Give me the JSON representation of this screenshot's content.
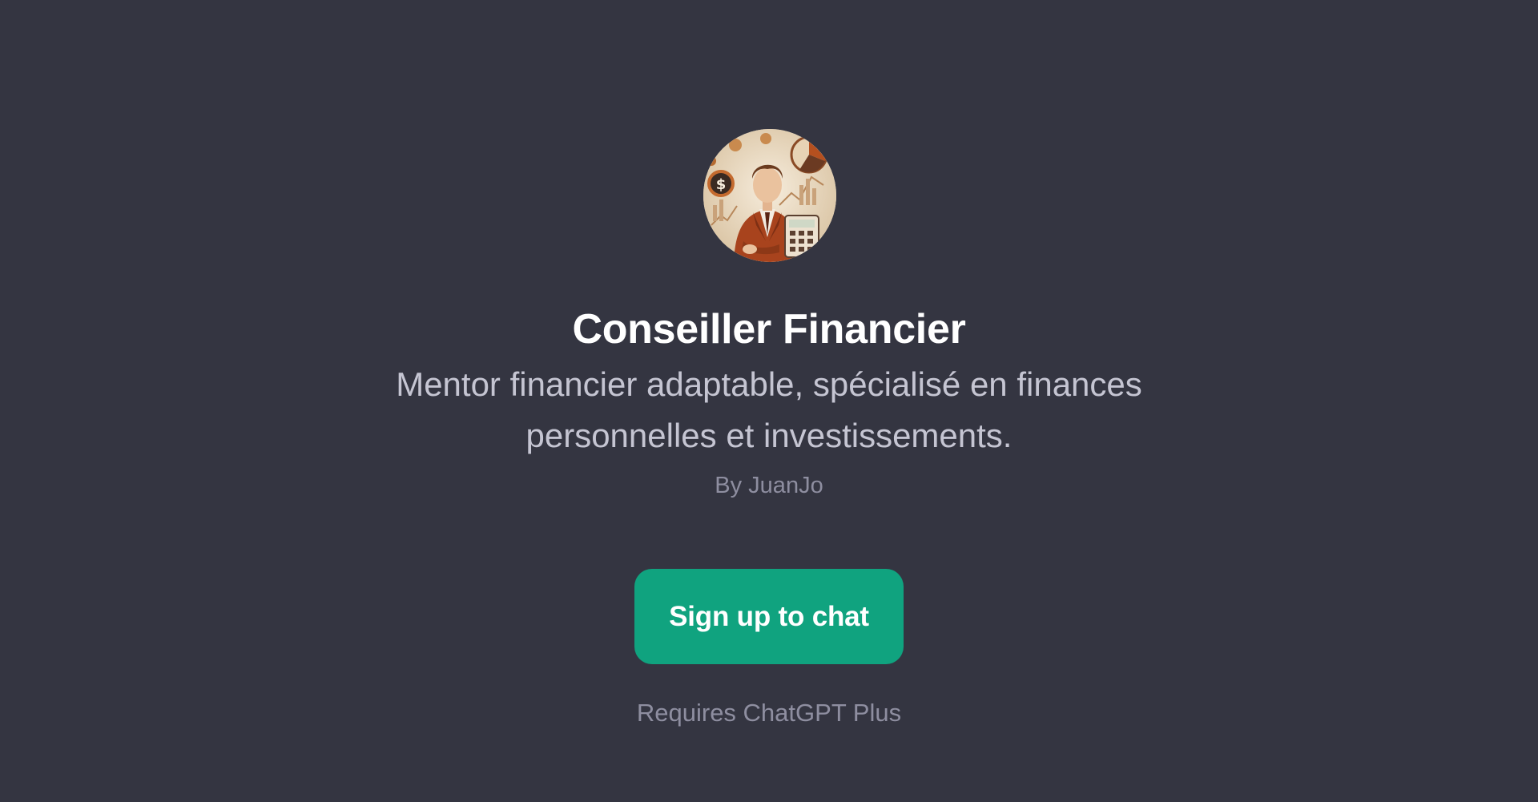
{
  "gpt": {
    "name": "Conseiller Financier",
    "description": "Mentor financier adaptable, spécialisé en finances personnelles et investissements.",
    "author": "By JuanJo",
    "avatar_icon": "financial-advisor-avatar"
  },
  "cta": {
    "label": "Sign up to chat"
  },
  "footer": {
    "requirement": "Requires ChatGPT Plus"
  },
  "colors": {
    "background": "#343541",
    "accent": "#10a37f",
    "title": "#ffffff",
    "description": "#c5c5d2",
    "muted": "#8e8ea0"
  }
}
